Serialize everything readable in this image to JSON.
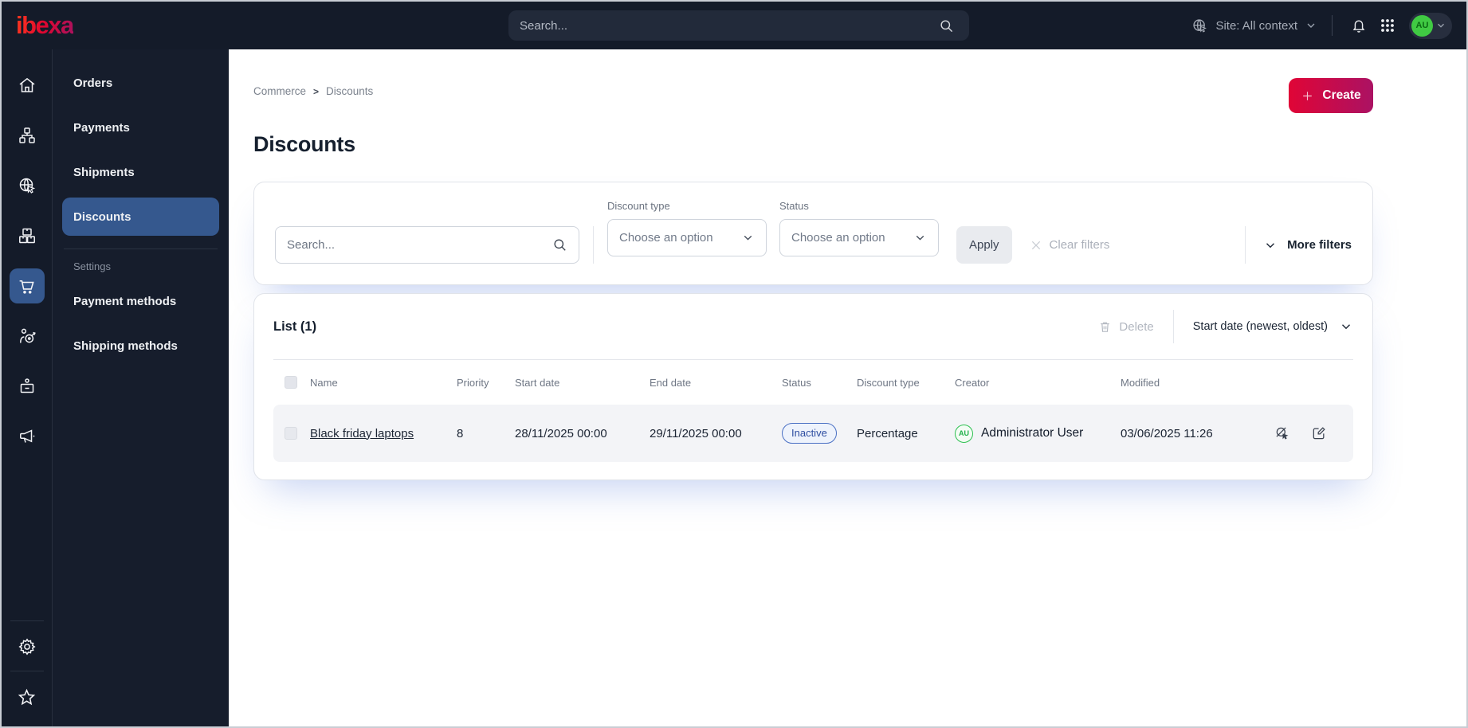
{
  "topbar": {
    "logo": "ibexa",
    "search_placeholder": "Search...",
    "site_context_label": "Site: All context",
    "avatar_initials": "AU"
  },
  "sidebar": {
    "rail_icons": [
      "home-icon",
      "content-tree-icon",
      "site-globe-cursor-icon",
      "product-boxes-icon",
      "commerce-cart-icon",
      "customer-target-icon",
      "order-badge-icon",
      "marketing-megaphone-icon",
      "settings-gear-icon",
      "bookmarks-star-icon"
    ],
    "rail_active": "commerce-cart-icon",
    "menu": {
      "items": [
        {
          "label": "Orders"
        },
        {
          "label": "Payments"
        },
        {
          "label": "Shipments"
        },
        {
          "label": "Discounts"
        }
      ],
      "active_item": "Discounts",
      "settings_label": "Settings",
      "settings_items": [
        {
          "label": "Payment methods"
        },
        {
          "label": "Shipping methods"
        }
      ]
    }
  },
  "breadcrumb": {
    "items": [
      {
        "label": "Commerce"
      },
      {
        "label": "Discounts"
      }
    ]
  },
  "page": {
    "title": "Discounts",
    "create_label": "Create"
  },
  "filters": {
    "search_placeholder": "Search...",
    "discount_type_label": "Discount type",
    "discount_type_value": "Choose an option",
    "status_label": "Status",
    "status_value": "Choose an option",
    "apply_label": "Apply",
    "clear_label": "Clear filters",
    "more_filters_label": "More filters"
  },
  "list": {
    "title": "List (1)",
    "delete_label": "Delete",
    "sort_label": "Start date (newest, oldest)",
    "columns": {
      "name": "Name",
      "priority": "Priority",
      "start_date": "Start date",
      "end_date": "End date",
      "status": "Status",
      "discount_type": "Discount type",
      "creator": "Creator",
      "modified": "Modified"
    },
    "rows": [
      {
        "name": "Black friday laptops",
        "priority": "8",
        "start_date": "28/11/2025 00:00",
        "end_date": "29/11/2025 00:00",
        "status": "Inactive",
        "discount_type": "Percentage",
        "creator_initials": "AU",
        "creator": "Administrator User",
        "modified": "03/06/2025 11:26"
      }
    ]
  },
  "colors": {
    "topbar_bg": "#141b29",
    "active_nav_blue": "#35588e",
    "create_gradient_start": "#e00536",
    "create_gradient_end": "#ab1263",
    "status_badge_border": "#4a70c4",
    "status_badge_text": "#2d4da1",
    "avatar_green": "#2ec151"
  }
}
